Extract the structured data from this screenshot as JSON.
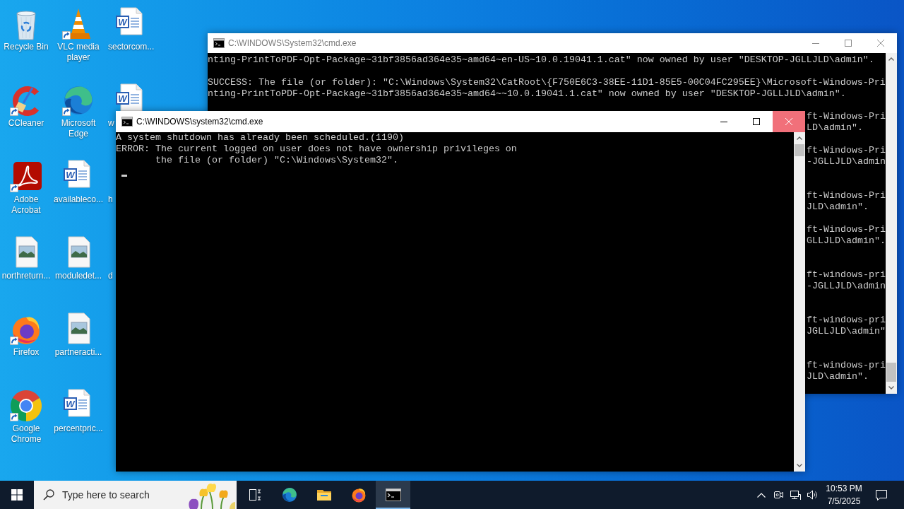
{
  "desktop": {
    "columns": [
      {
        "cut_by_window": false,
        "icons": [
          {
            "label": "Recycle Bin",
            "kind": "recycle-bin",
            "shortcut": false
          },
          {
            "label": "CCleaner",
            "kind": "ccleaner",
            "shortcut": true
          },
          {
            "label": "Adobe Acrobat",
            "kind": "acrobat",
            "shortcut": true
          },
          {
            "label": "northreturn...",
            "kind": "image",
            "shortcut": false
          },
          {
            "label": "Firefox",
            "kind": "firefox",
            "shortcut": true
          },
          {
            "label": "Google Chrome",
            "kind": "chrome",
            "shortcut": true
          }
        ]
      },
      {
        "cut_by_window": false,
        "icons": [
          {
            "label": "VLC media player",
            "kind": "vlc",
            "shortcut": true
          },
          {
            "label": "Microsoft Edge",
            "kind": "edge",
            "shortcut": true
          },
          {
            "label": "availableco...",
            "kind": "word",
            "badge": "W",
            "shortcut": false
          },
          {
            "label": "moduledet...",
            "kind": "image",
            "shortcut": false
          },
          {
            "label": "partneracti...",
            "kind": "image",
            "shortcut": false
          },
          {
            "label": "percentpric...",
            "kind": "word",
            "badge": "W",
            "shortcut": false
          }
        ]
      },
      {
        "cut_by_window": true,
        "icons": [
          {
            "label": "sectorcom...",
            "kind": "word",
            "badge": "W",
            "shortcut": false
          },
          {
            "label": "w",
            "kind": "word",
            "badge": "W",
            "shortcut": false
          },
          {
            "label": "h"
          },
          {
            "label": "d"
          }
        ]
      }
    ]
  },
  "windows": [
    {
      "title": "C:\\WINDOWS\\System32\\cmd.exe",
      "active": false,
      "close_hovered": false,
      "lines": [
        {
          "kind": "output",
          "text": "nting-PrintToPDF-Opt-Package~31bf3856ad364e35~amd64~en-US~10.0.19041.1.cat\" now owned by user \"DESKTOP-JGLLJLD\\admin\"."
        },
        {
          "kind": "blank"
        },
        {
          "kind": "output",
          "text": "SUCCESS: The file (or folder): \"C:\\Windows\\System32\\CatRoot\\{F750E6C3-38EE-11D1-85E5-00C04FC295EE}\\Microsoft-Windows-Pri"
        },
        {
          "kind": "output",
          "text": "nting-PrintToPDF-Opt-Package~31bf3856ad364e35~amd64~~10.0.19041.1.cat\" now owned by user \"DESKTOP-JGLLJLD\\admin\"."
        },
        {
          "kind": "blank"
        },
        {
          "kind": "clipped",
          "text": "ft-Windows-Pri"
        },
        {
          "kind": "clipped",
          "text": "LD\\admin\"."
        },
        {
          "kind": "blank"
        },
        {
          "kind": "clipped",
          "text": "ft-Windows-Pri"
        },
        {
          "kind": "clipped",
          "text": "-JGLLJLD\\admin"
        },
        {
          "kind": "blank"
        },
        {
          "kind": "blank"
        },
        {
          "kind": "clipped",
          "text": "ft-Windows-Pri"
        },
        {
          "kind": "clipped",
          "text": "JLD\\admin\"."
        },
        {
          "kind": "blank"
        },
        {
          "kind": "clipped",
          "text": "ft-Windows-Pri"
        },
        {
          "kind": "clipped",
          "text": "GLLJLD\\admin\"."
        },
        {
          "kind": "blank"
        },
        {
          "kind": "blank"
        },
        {
          "kind": "clipped",
          "text": "ft-windows-pri"
        },
        {
          "kind": "clipped",
          "text": "-JGLLJLD\\admin"
        },
        {
          "kind": "blank"
        },
        {
          "kind": "blank"
        },
        {
          "kind": "clipped",
          "text": "ft-windows-pri"
        },
        {
          "kind": "clipped",
          "text": "JGLLJLD\\admin\""
        },
        {
          "kind": "blank"
        },
        {
          "kind": "blank"
        },
        {
          "kind": "clipped",
          "text": "ft-windows-pri"
        },
        {
          "kind": "clipped",
          "text": "JLD\\admin\"."
        }
      ]
    },
    {
      "title": "C:\\WINDOWS\\system32\\cmd.exe",
      "active": true,
      "close_hovered": true,
      "cursor": true,
      "lines": [
        {
          "kind": "output",
          "text": "A system shutdown has already been scheduled.(1190)"
        },
        {
          "kind": "output",
          "text": "ERROR: The current logged on user does not have ownership privileges on"
        },
        {
          "kind": "continuation",
          "text": "the file (or folder) \"C:\\Windows\\System32\"."
        }
      ]
    }
  ],
  "taskbar": {
    "search": {
      "placeholder": "Type here to search"
    },
    "apps": [
      {
        "kind": "task-view",
        "selected": false
      },
      {
        "kind": "edge",
        "selected": false
      },
      {
        "kind": "file-explorer",
        "selected": false
      },
      {
        "kind": "firefox",
        "selected": false
      },
      {
        "kind": "terminal",
        "selected": true
      }
    ],
    "clock": {
      "time": "10:53 PM",
      "date": "7/5/2025"
    }
  }
}
